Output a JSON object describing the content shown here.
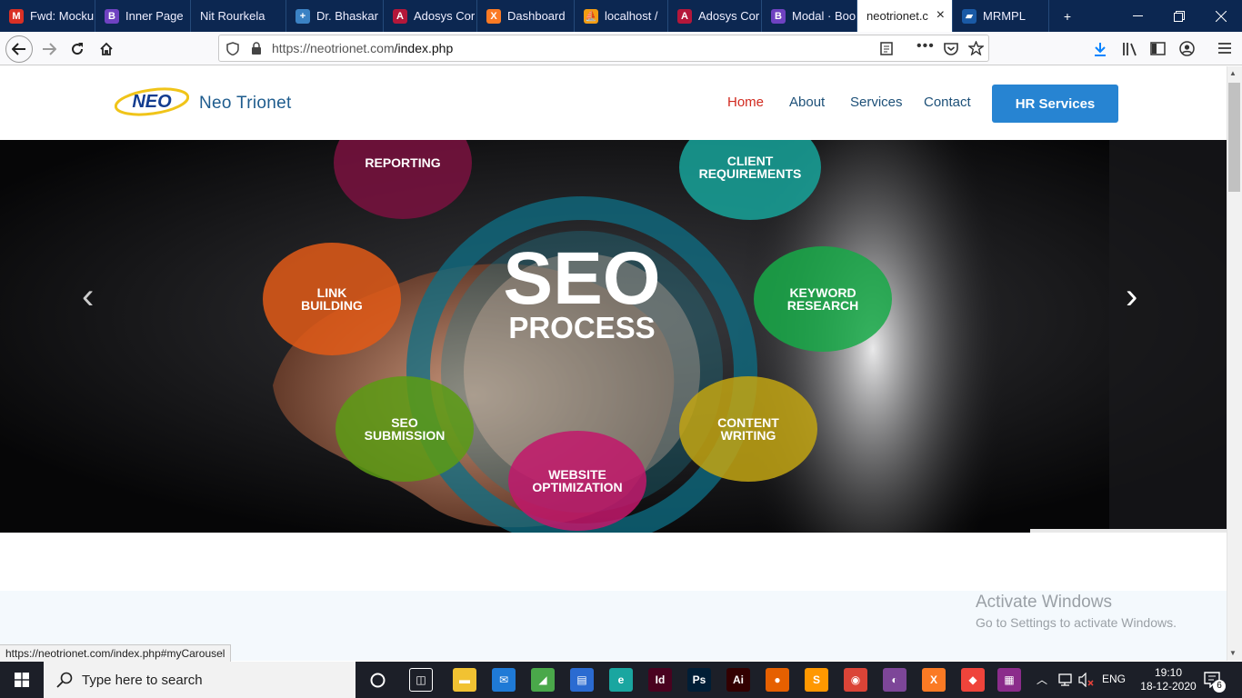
{
  "browser": {
    "tabs": [
      {
        "title": "Fwd: Mocku",
        "icon": "gmail-icon",
        "color": "#d93025",
        "glyph": "M"
      },
      {
        "title": "Inner Page",
        "icon": "bootstrap-icon",
        "color": "#6f42c1",
        "glyph": "B"
      },
      {
        "title": "Nit Rourkela",
        "icon": "",
        "color": "",
        "glyph": ""
      },
      {
        "title": "Dr. Bhaskar",
        "icon": "medical-icon",
        "color": "#3b82c4",
        "glyph": "+"
      },
      {
        "title": "Adosys Cor",
        "icon": "adosys-icon",
        "color": "#b4173a",
        "glyph": "A"
      },
      {
        "title": "Dashboard",
        "icon": "xampp-icon",
        "color": "#fb7a24",
        "glyph": "X"
      },
      {
        "title": "localhost / ",
        "icon": "phpmyadmin-icon",
        "color": "#f39c12",
        "glyph": "⛵"
      },
      {
        "title": "Adosys Cor",
        "icon": "adosys-icon",
        "color": "#b4173a",
        "glyph": "A"
      },
      {
        "title": "Modal · Boo",
        "icon": "bootstrap-icon",
        "color": "#6f42c1",
        "glyph": "B"
      },
      {
        "title": "neotrionet.c",
        "icon": "",
        "color": "",
        "glyph": "",
        "active": true
      },
      {
        "title": "MRMPL",
        "icon": "mrmpl-icon",
        "color": "#1a5aa6",
        "glyph": "▰"
      }
    ],
    "new_tab": "+",
    "url_host": "https://neotrionet.com",
    "url_path": "/index.php",
    "status_url": "https://neotrionet.com/index.php#myCarousel"
  },
  "site": {
    "brand": "Neo Trionet",
    "logo_text": "NEO",
    "nav": [
      "Home",
      "About",
      "Services",
      "Contact"
    ],
    "cta": "HR Services",
    "colors": {
      "nav_active": "#d12a1f",
      "nav": "#1d5078",
      "cta": "#2784d2"
    }
  },
  "hero": {
    "center_title": "SEO",
    "center_subtitle": "PROCESS",
    "bubbles": [
      {
        "l1": "REPORTING",
        "l2": "",
        "color": "#7a1240"
      },
      {
        "l1": "CLIENT",
        "l2": "REQUIREMENTS",
        "color": "#17a39a"
      },
      {
        "l1": "LINK",
        "l2": "BUILDING",
        "color": "#e25a17"
      },
      {
        "l1": "KEYWORD",
        "l2": "RESEARCH",
        "color": "#18a948"
      },
      {
        "l1": "SEO",
        "l2": "SUBMISSION",
        "color": "#5c9b14"
      },
      {
        "l1": "CONTENT",
        "l2": "WRITING",
        "color": "#c2a413"
      },
      {
        "l1": "WEBSITE",
        "l2": "OPTIMIZATION",
        "color": "#c2186b"
      }
    ],
    "prev_glyph": "‹",
    "next_glyph": "›"
  },
  "overlay": {
    "watermark_title": "Activate Windows",
    "watermark_sub": "Go to Settings to activate Windows."
  },
  "taskbar": {
    "search_placeholder": "Type here to search",
    "time": "19:10",
    "date": "18-12-2020",
    "lang": "ENG",
    "notifications": "6",
    "apps": [
      {
        "name": "task-view-icon",
        "color": "transparent",
        "glyph": "◫"
      },
      {
        "name": "file-explorer-icon",
        "color": "#f1c232",
        "glyph": "▬"
      },
      {
        "name": "mail-icon",
        "color": "#1f7ad6",
        "glyph": "✉"
      },
      {
        "name": "photo-app-icon",
        "color": "#4aa84a",
        "glyph": "◢"
      },
      {
        "name": "store-icon",
        "color": "#2b6bd1",
        "glyph": "▤"
      },
      {
        "name": "edge-icon",
        "color": "#1aa6a0",
        "glyph": "e"
      },
      {
        "name": "indesign-icon",
        "color": "#49021f",
        "glyph": "Id"
      },
      {
        "name": "photoshop-icon",
        "color": "#001e36",
        "glyph": "Ps"
      },
      {
        "name": "illustrator-icon",
        "color": "#330000",
        "glyph": "Ai"
      },
      {
        "name": "firefox-icon",
        "color": "#e66000",
        "glyph": "●"
      },
      {
        "name": "sublime-icon",
        "color": "#ff9800",
        "glyph": "S"
      },
      {
        "name": "chrome-icon",
        "color": "#db4437",
        "glyph": "◉"
      },
      {
        "name": "tor-icon",
        "color": "#7d4698",
        "glyph": "◐"
      },
      {
        "name": "xampp-icon",
        "color": "#fb7a24",
        "glyph": "X"
      },
      {
        "name": "anydesk-icon",
        "color": "#ef443b",
        "glyph": "◆"
      },
      {
        "name": "winrar-icon",
        "color": "#8b2c8b",
        "glyph": "▦"
      }
    ]
  }
}
